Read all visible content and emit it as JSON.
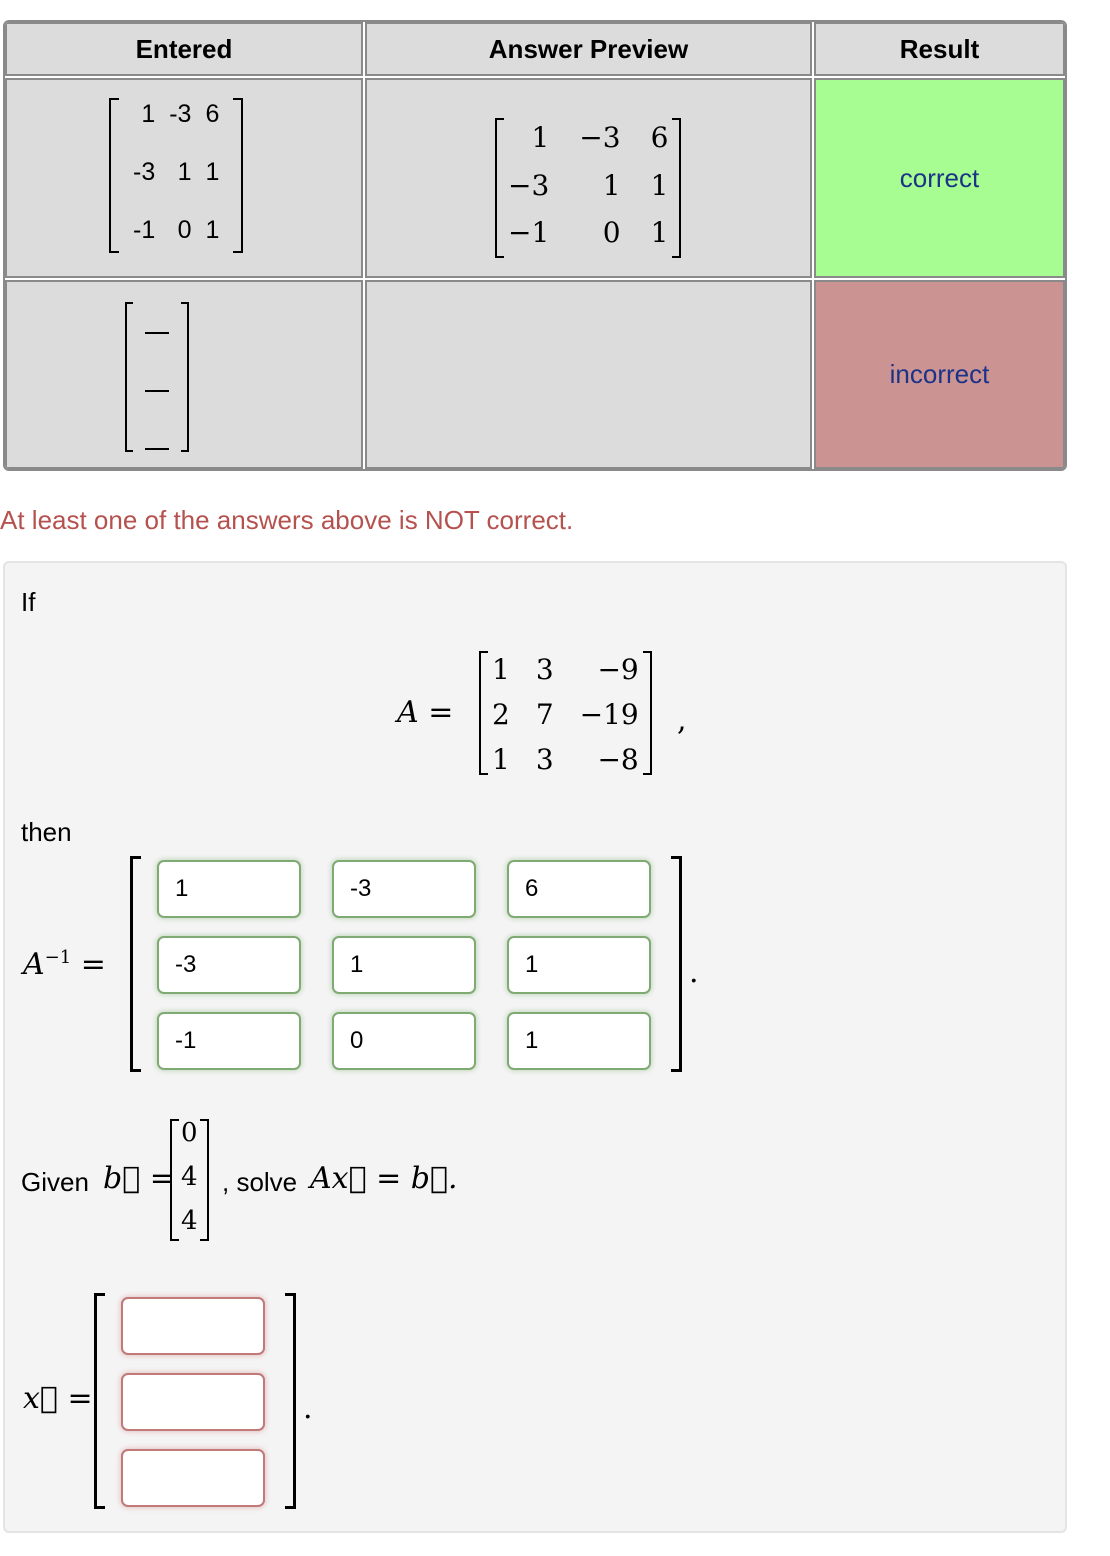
{
  "results_table": {
    "headers": [
      "Entered",
      "Answer Preview",
      "Result"
    ],
    "rows": [
      {
        "entered": [
          [
            "1",
            "-3",
            "6"
          ],
          [
            "-3",
            "1",
            "1"
          ],
          [
            "-1",
            "0",
            "1"
          ]
        ],
        "preview": [
          [
            "1",
            "−3",
            "6"
          ],
          [
            "−3",
            "1",
            "1"
          ],
          [
            "−1",
            "0",
            "1"
          ]
        ],
        "result": "correct"
      },
      {
        "entered": [
          [
            "—"
          ],
          [
            "—"
          ],
          [
            "—"
          ]
        ],
        "preview": [],
        "result": "incorrect"
      }
    ],
    "colors": {
      "correct": "#a7fd92",
      "incorrect": "#cc9393",
      "result_text": "#1b3386"
    }
  },
  "warning": "At least one of the answers above is NOT correct.",
  "problem": {
    "intro": "If",
    "matrix_A_label": "A =",
    "matrix_A": [
      [
        "1",
        "3",
        "−9"
      ],
      [
        "2",
        "7",
        "−19"
      ],
      [
        "1",
        "3",
        "−8"
      ]
    ],
    "matrix_A_suffix": ",",
    "then": "then",
    "inverse_label": "A",
    "inverse_sup": "−1",
    "equals": "=",
    "inverse_inputs": [
      [
        "1",
        "-3",
        "6"
      ],
      [
        "-3",
        "1",
        "1"
      ],
      [
        "-1",
        "0",
        "1"
      ]
    ],
    "period": ".",
    "given_text": "Given",
    "b_symbol": "b⃗",
    "b_vector": [
      "0",
      "4",
      "4"
    ],
    "solve_text": ", solve",
    "solve_equation": "Ax⃗ = b⃗.",
    "x_label": "x⃗ =",
    "x_inputs": [
      "",
      "",
      ""
    ]
  }
}
